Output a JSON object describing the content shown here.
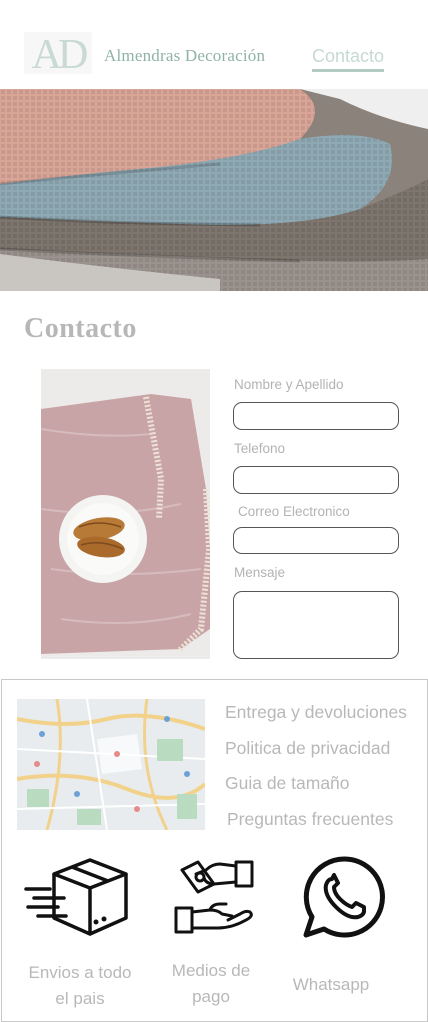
{
  "header": {
    "logo_text": "AD",
    "brand_name": "Almendras Decoración",
    "nav_contact": "Contacto"
  },
  "page": {
    "title": "Contacto"
  },
  "form": {
    "name_label": "Nombre y Apellido",
    "phone_label": "Telefono",
    "email_label": "Correo Electronico",
    "message_label": "Mensaje"
  },
  "footer": {
    "links": [
      "Entrega y devoluciones",
      "Politica de privacidad",
      "Guia de tamaño",
      "Preguntas frecuentes"
    ],
    "features": {
      "shipping_line1": "Envios a todo",
      "shipping_line2": "el pais",
      "payment_line1": "Medios de",
      "payment_line2": "pago",
      "whatsapp": "Whatsapp"
    }
  },
  "colors": {
    "brand": "#8fb3a7",
    "nav_underline": "#b3cbc4",
    "muted_text": "#b3b3b3"
  },
  "icons": [
    "logo-monogram",
    "delivery-box-icon",
    "payment-hands-icon",
    "whatsapp-icon"
  ]
}
